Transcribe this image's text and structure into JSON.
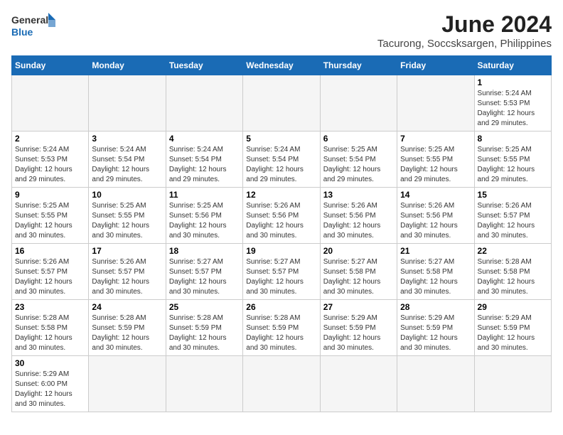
{
  "logo": {
    "line1": "General",
    "line2": "Blue"
  },
  "title": "June 2024",
  "subtitle": "Tacurong, Soccsksargen, Philippines",
  "days_of_week": [
    "Sunday",
    "Monday",
    "Tuesday",
    "Wednesday",
    "Thursday",
    "Friday",
    "Saturday"
  ],
  "weeks": [
    [
      {
        "day": "",
        "info": "",
        "empty": true
      },
      {
        "day": "",
        "info": "",
        "empty": true
      },
      {
        "day": "",
        "info": "",
        "empty": true
      },
      {
        "day": "",
        "info": "",
        "empty": true
      },
      {
        "day": "",
        "info": "",
        "empty": true
      },
      {
        "day": "",
        "info": "",
        "empty": true
      },
      {
        "day": "1",
        "info": "Sunrise: 5:24 AM\nSunset: 5:53 PM\nDaylight: 12 hours and 29 minutes.",
        "empty": false
      }
    ],
    [
      {
        "day": "2",
        "info": "Sunrise: 5:24 AM\nSunset: 5:53 PM\nDaylight: 12 hours and 29 minutes.",
        "empty": false
      },
      {
        "day": "3",
        "info": "Sunrise: 5:24 AM\nSunset: 5:54 PM\nDaylight: 12 hours and 29 minutes.",
        "empty": false
      },
      {
        "day": "4",
        "info": "Sunrise: 5:24 AM\nSunset: 5:54 PM\nDaylight: 12 hours and 29 minutes.",
        "empty": false
      },
      {
        "day": "5",
        "info": "Sunrise: 5:24 AM\nSunset: 5:54 PM\nDaylight: 12 hours and 29 minutes.",
        "empty": false
      },
      {
        "day": "6",
        "info": "Sunrise: 5:25 AM\nSunset: 5:54 PM\nDaylight: 12 hours and 29 minutes.",
        "empty": false
      },
      {
        "day": "7",
        "info": "Sunrise: 5:25 AM\nSunset: 5:55 PM\nDaylight: 12 hours and 29 minutes.",
        "empty": false
      },
      {
        "day": "8",
        "info": "Sunrise: 5:25 AM\nSunset: 5:55 PM\nDaylight: 12 hours and 29 minutes.",
        "empty": false
      }
    ],
    [
      {
        "day": "9",
        "info": "Sunrise: 5:25 AM\nSunset: 5:55 PM\nDaylight: 12 hours and 30 minutes.",
        "empty": false
      },
      {
        "day": "10",
        "info": "Sunrise: 5:25 AM\nSunset: 5:55 PM\nDaylight: 12 hours and 30 minutes.",
        "empty": false
      },
      {
        "day": "11",
        "info": "Sunrise: 5:25 AM\nSunset: 5:56 PM\nDaylight: 12 hours and 30 minutes.",
        "empty": false
      },
      {
        "day": "12",
        "info": "Sunrise: 5:26 AM\nSunset: 5:56 PM\nDaylight: 12 hours and 30 minutes.",
        "empty": false
      },
      {
        "day": "13",
        "info": "Sunrise: 5:26 AM\nSunset: 5:56 PM\nDaylight: 12 hours and 30 minutes.",
        "empty": false
      },
      {
        "day": "14",
        "info": "Sunrise: 5:26 AM\nSunset: 5:56 PM\nDaylight: 12 hours and 30 minutes.",
        "empty": false
      },
      {
        "day": "15",
        "info": "Sunrise: 5:26 AM\nSunset: 5:57 PM\nDaylight: 12 hours and 30 minutes.",
        "empty": false
      }
    ],
    [
      {
        "day": "16",
        "info": "Sunrise: 5:26 AM\nSunset: 5:57 PM\nDaylight: 12 hours and 30 minutes.",
        "empty": false
      },
      {
        "day": "17",
        "info": "Sunrise: 5:26 AM\nSunset: 5:57 PM\nDaylight: 12 hours and 30 minutes.",
        "empty": false
      },
      {
        "day": "18",
        "info": "Sunrise: 5:27 AM\nSunset: 5:57 PM\nDaylight: 12 hours and 30 minutes.",
        "empty": false
      },
      {
        "day": "19",
        "info": "Sunrise: 5:27 AM\nSunset: 5:57 PM\nDaylight: 12 hours and 30 minutes.",
        "empty": false
      },
      {
        "day": "20",
        "info": "Sunrise: 5:27 AM\nSunset: 5:58 PM\nDaylight: 12 hours and 30 minutes.",
        "empty": false
      },
      {
        "day": "21",
        "info": "Sunrise: 5:27 AM\nSunset: 5:58 PM\nDaylight: 12 hours and 30 minutes.",
        "empty": false
      },
      {
        "day": "22",
        "info": "Sunrise: 5:28 AM\nSunset: 5:58 PM\nDaylight: 12 hours and 30 minutes.",
        "empty": false
      }
    ],
    [
      {
        "day": "23",
        "info": "Sunrise: 5:28 AM\nSunset: 5:58 PM\nDaylight: 12 hours and 30 minutes.",
        "empty": false
      },
      {
        "day": "24",
        "info": "Sunrise: 5:28 AM\nSunset: 5:59 PM\nDaylight: 12 hours and 30 minutes.",
        "empty": false
      },
      {
        "day": "25",
        "info": "Sunrise: 5:28 AM\nSunset: 5:59 PM\nDaylight: 12 hours and 30 minutes.",
        "empty": false
      },
      {
        "day": "26",
        "info": "Sunrise: 5:28 AM\nSunset: 5:59 PM\nDaylight: 12 hours and 30 minutes.",
        "empty": false
      },
      {
        "day": "27",
        "info": "Sunrise: 5:29 AM\nSunset: 5:59 PM\nDaylight: 12 hours and 30 minutes.",
        "empty": false
      },
      {
        "day": "28",
        "info": "Sunrise: 5:29 AM\nSunset: 5:59 PM\nDaylight: 12 hours and 30 minutes.",
        "empty": false
      },
      {
        "day": "29",
        "info": "Sunrise: 5:29 AM\nSunset: 5:59 PM\nDaylight: 12 hours and 30 minutes.",
        "empty": false
      }
    ],
    [
      {
        "day": "30",
        "info": "Sunrise: 5:29 AM\nSunset: 6:00 PM\nDaylight: 12 hours and 30 minutes.",
        "empty": false
      },
      {
        "day": "",
        "info": "",
        "empty": true
      },
      {
        "day": "",
        "info": "",
        "empty": true
      },
      {
        "day": "",
        "info": "",
        "empty": true
      },
      {
        "day": "",
        "info": "",
        "empty": true
      },
      {
        "day": "",
        "info": "",
        "empty": true
      },
      {
        "day": "",
        "info": "",
        "empty": true
      }
    ]
  ]
}
